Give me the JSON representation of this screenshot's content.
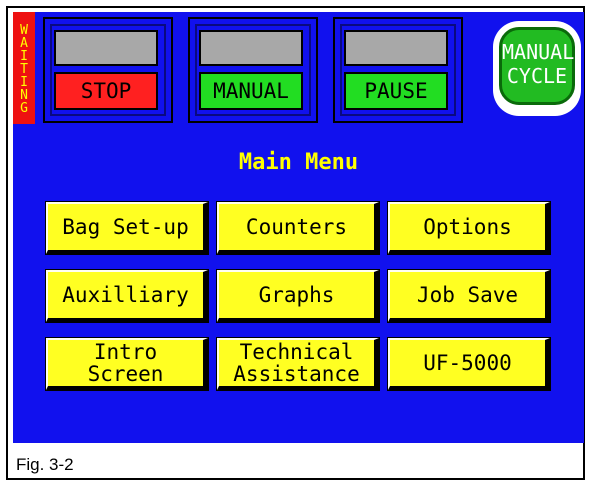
{
  "status": {
    "label": "WAITING",
    "letters": [
      "W",
      "A",
      "I",
      "T",
      "I",
      "N",
      "G"
    ]
  },
  "controls": [
    {
      "label": "STOP",
      "color": "#ff2020"
    },
    {
      "label": "MANUAL",
      "color": "#22dd22"
    },
    {
      "label": "PAUSE",
      "color": "#22dd22"
    }
  ],
  "cycle_button": {
    "line1": "MANUAL",
    "line2": "CYCLE"
  },
  "menu": {
    "title": "Main Menu",
    "items": [
      {
        "line1": "Bag Set-up",
        "line2": ""
      },
      {
        "line1": "Counters",
        "line2": ""
      },
      {
        "line1": "Options",
        "line2": ""
      },
      {
        "line1": "Auxilliary",
        "line2": ""
      },
      {
        "line1": "Graphs",
        "line2": ""
      },
      {
        "line1": "Job Save",
        "line2": ""
      },
      {
        "line1": "Intro",
        "line2": "Screen"
      },
      {
        "line1": "Technical",
        "line2": "Assistance"
      },
      {
        "line1": "UF-5000",
        "line2": ""
      }
    ]
  },
  "caption": "Fig. 3-2"
}
